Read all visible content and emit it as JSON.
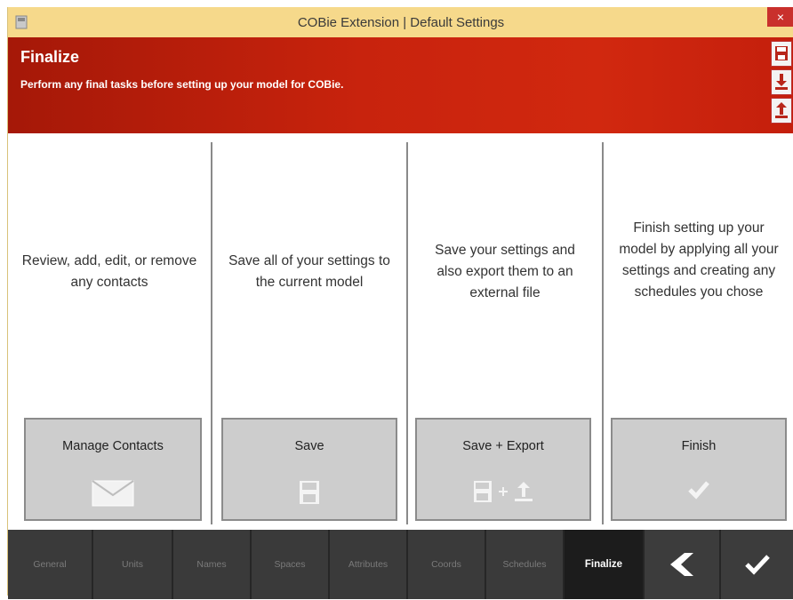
{
  "window": {
    "title": "COBie Extension | Default Settings",
    "close_label": "×"
  },
  "header": {
    "title": "Finalize",
    "subtitle": "Perform any final tasks before setting up your model for COBie.",
    "tools": [
      "save-icon",
      "download-icon",
      "upload-icon"
    ]
  },
  "panels": [
    {
      "description": "Review, add, edit, or remove any contacts",
      "button": "Manage Contacts",
      "icon": "envelope-icon"
    },
    {
      "description": "Save all of your settings to the current model",
      "button": "Save",
      "icon": "floppy-icon"
    },
    {
      "description": "Save your settings and also export them to an external file",
      "button": "Save + Export",
      "icon": "floppy-plus-export-icon"
    },
    {
      "description": "Finish setting up your model by applying all your settings and creating any schedules you chose",
      "button": "Finish",
      "icon": "checkmark-icon"
    }
  ],
  "nav": {
    "tabs": [
      "General",
      "Units",
      "Names",
      "Spaces",
      "Attributes",
      "Coords",
      "Schedules",
      "Finalize"
    ],
    "active": "Finalize",
    "back_icon": "back-chevron-icon",
    "confirm_icon": "checkmark-icon"
  },
  "colors": {
    "accent": "#c8230d",
    "titlebar": "#f6d98b",
    "nav_bg": "#3a3a3a",
    "button_bg": "#cdcdcd"
  }
}
